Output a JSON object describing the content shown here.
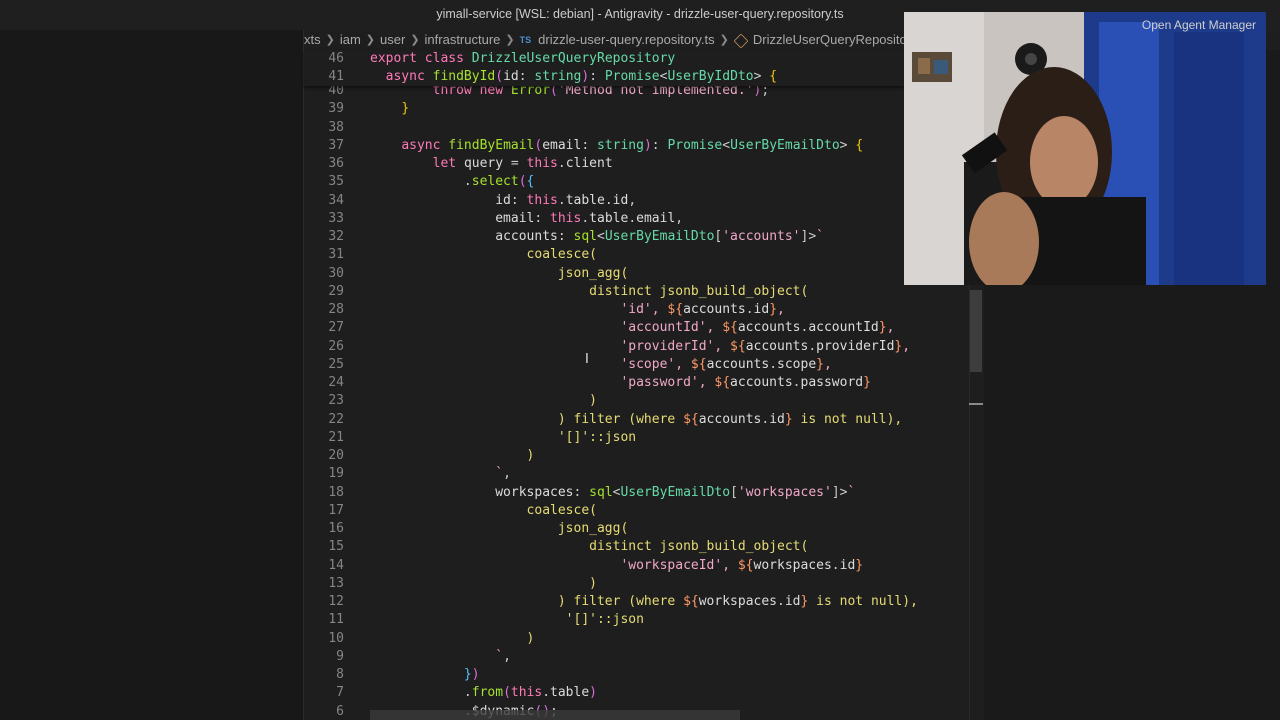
{
  "window": {
    "title": "yimall-service [WSL: debian] - Antigravity - drizzle-user-query.repository.ts"
  },
  "breadcrumbs": {
    "items": [
      "xts",
      "iam",
      "user",
      "infrastructure"
    ],
    "file_badge": "TS",
    "file_name": "drizzle-user-query.repository.ts",
    "symbol": "DrizzleUserQueryRepository"
  },
  "sticky_scroll": [
    {
      "ln": "46",
      "tokens": [
        [
          "kw",
          "export "
        ],
        [
          "kw",
          "class "
        ],
        [
          "ty",
          "DrizzleUserQueryRepository"
        ]
      ]
    },
    {
      "ln": "41",
      "tokens": [
        [
          "pn",
          "  "
        ],
        [
          "kw",
          "async "
        ],
        [
          "fn",
          "findById"
        ],
        [
          "br2",
          "("
        ],
        [
          "pr",
          "id"
        ],
        [
          "pn",
          ": "
        ],
        [
          "ty",
          "string"
        ],
        [
          "br2",
          ")"
        ],
        [
          "pn",
          ": "
        ],
        [
          "ty",
          "Promise"
        ],
        [
          "pn",
          "<"
        ],
        [
          "ty",
          "UserByIdDto"
        ],
        [
          "pn",
          "> "
        ],
        [
          "br",
          "{"
        ]
      ]
    }
  ],
  "code_lines": [
    {
      "ln": "40",
      "tokens": [
        [
          "pn",
          "        "
        ],
        [
          "kw",
          "throw "
        ],
        [
          "kw",
          "new "
        ],
        [
          "fn",
          "Error"
        ],
        [
          "br2",
          "("
        ],
        [
          "str",
          "'Method not implemented.'"
        ],
        [
          "br2",
          ")"
        ],
        [
          "pn",
          ";"
        ]
      ]
    },
    {
      "ln": "39",
      "tokens": [
        [
          "pn",
          "    "
        ],
        [
          "br",
          "}"
        ]
      ]
    },
    {
      "ln": "38",
      "tokens": []
    },
    {
      "ln": "37",
      "tokens": [
        [
          "pn",
          "    "
        ],
        [
          "kw",
          "async "
        ],
        [
          "fn",
          "findByEmail"
        ],
        [
          "br2",
          "("
        ],
        [
          "pr",
          "email"
        ],
        [
          "pn",
          ": "
        ],
        [
          "ty",
          "string"
        ],
        [
          "br2",
          ")"
        ],
        [
          "pn",
          ": "
        ],
        [
          "ty",
          "Promise"
        ],
        [
          "pn",
          "<"
        ],
        [
          "ty",
          "UserByEmailDto"
        ],
        [
          "pn",
          "> "
        ],
        [
          "br",
          "{"
        ]
      ]
    },
    {
      "ln": "36",
      "tokens": [
        [
          "pn",
          "        "
        ],
        [
          "kw",
          "let "
        ],
        [
          "pr",
          "query"
        ],
        [
          "pn",
          " = "
        ],
        [
          "kw",
          "this"
        ],
        [
          "pn",
          "."
        ],
        [
          "pr",
          "client"
        ]
      ]
    },
    {
      "ln": "35",
      "tokens": [
        [
          "pn",
          "            ."
        ],
        [
          "fn",
          "select"
        ],
        [
          "br2",
          "("
        ],
        [
          "br3",
          "{"
        ]
      ]
    },
    {
      "ln": "34",
      "tokens": [
        [
          "pn",
          "                "
        ],
        [
          "pr",
          "id"
        ],
        [
          "pn",
          ": "
        ],
        [
          "kw",
          "this"
        ],
        [
          "pn",
          "."
        ],
        [
          "pr",
          "table"
        ],
        [
          "pn",
          "."
        ],
        [
          "pr",
          "id"
        ],
        [
          "pn",
          ","
        ]
      ]
    },
    {
      "ln": "33",
      "tokens": [
        [
          "pn",
          "                "
        ],
        [
          "pr",
          "email"
        ],
        [
          "pn",
          ": "
        ],
        [
          "kw",
          "this"
        ],
        [
          "pn",
          "."
        ],
        [
          "pr",
          "table"
        ],
        [
          "pn",
          "."
        ],
        [
          "pr",
          "email"
        ],
        [
          "pn",
          ","
        ]
      ]
    },
    {
      "ln": "32",
      "tokens": [
        [
          "pn",
          "                "
        ],
        [
          "pr",
          "accounts"
        ],
        [
          "pn",
          ": "
        ],
        [
          "fn",
          "sql"
        ],
        [
          "pn",
          "<"
        ],
        [
          "ty",
          "UserByEmailDto"
        ],
        [
          "pn",
          "["
        ],
        [
          "str",
          "'accounts'"
        ],
        [
          "pn",
          "]>"
        ],
        [
          "str",
          "`"
        ]
      ]
    },
    {
      "ln": "31",
      "tokens": [
        [
          "pn",
          "                    "
        ],
        [
          "st",
          "coalesce("
        ]
      ]
    },
    {
      "ln": "30",
      "tokens": [
        [
          "pn",
          "                        "
        ],
        [
          "st",
          "json_agg("
        ]
      ]
    },
    {
      "ln": "29",
      "tokens": [
        [
          "pn",
          "                            "
        ],
        [
          "st",
          "distinct jsonb_build_object("
        ]
      ]
    },
    {
      "ln": "28",
      "tokens": [
        [
          "pn",
          "                                "
        ],
        [
          "str",
          "'id'"
        ],
        [
          "str",
          ", "
        ],
        [
          "tp",
          "${"
        ],
        [
          "pr",
          "accounts"
        ],
        [
          "pn",
          "."
        ],
        [
          "pr",
          "id"
        ],
        [
          "tp",
          "}"
        ],
        [
          "str",
          ","
        ]
      ]
    },
    {
      "ln": "27",
      "tokens": [
        [
          "pn",
          "                                "
        ],
        [
          "str",
          "'accountId'"
        ],
        [
          "str",
          ", "
        ],
        [
          "tp",
          "${"
        ],
        [
          "pr",
          "accounts"
        ],
        [
          "pn",
          "."
        ],
        [
          "pr",
          "accountId"
        ],
        [
          "tp",
          "}"
        ],
        [
          "str",
          ","
        ]
      ]
    },
    {
      "ln": "26",
      "tokens": [
        [
          "pn",
          "                                "
        ],
        [
          "str",
          "'providerId'"
        ],
        [
          "str",
          ", "
        ],
        [
          "tp",
          "${"
        ],
        [
          "pr",
          "accounts"
        ],
        [
          "pn",
          "."
        ],
        [
          "pr",
          "providerId"
        ],
        [
          "tp",
          "}"
        ],
        [
          "str",
          ","
        ]
      ]
    },
    {
      "ln": "25",
      "tokens": [
        [
          "pn",
          "                                "
        ],
        [
          "str",
          "'scope'"
        ],
        [
          "str",
          ", "
        ],
        [
          "tp",
          "${"
        ],
        [
          "pr",
          "accounts"
        ],
        [
          "pn",
          "."
        ],
        [
          "pr",
          "scope"
        ],
        [
          "tp",
          "}"
        ],
        [
          "str",
          ","
        ]
      ]
    },
    {
      "ln": "24",
      "tokens": [
        [
          "pn",
          "                                "
        ],
        [
          "str",
          "'password'"
        ],
        [
          "str",
          ", "
        ],
        [
          "tp",
          "${"
        ],
        [
          "pr",
          "accounts"
        ],
        [
          "pn",
          "."
        ],
        [
          "pr",
          "password"
        ],
        [
          "tp",
          "}"
        ]
      ]
    },
    {
      "ln": "23",
      "tokens": [
        [
          "pn",
          "                            "
        ],
        [
          "st",
          ")"
        ]
      ]
    },
    {
      "ln": "22",
      "tokens": [
        [
          "pn",
          "                        "
        ],
        [
          "st",
          ") filter (where "
        ],
        [
          "tp",
          "${"
        ],
        [
          "pr",
          "accounts"
        ],
        [
          "pn",
          "."
        ],
        [
          "pr",
          "id"
        ],
        [
          "tp",
          "}"
        ],
        [
          "st",
          " is not null),"
        ]
      ]
    },
    {
      "ln": "21",
      "tokens": [
        [
          "pn",
          "                        "
        ],
        [
          "st",
          "'[]'::json"
        ]
      ]
    },
    {
      "ln": "20",
      "tokens": [
        [
          "pn",
          "                    "
        ],
        [
          "st",
          ")"
        ]
      ]
    },
    {
      "ln": "19",
      "tokens": [
        [
          "pn",
          "                "
        ],
        [
          "str",
          "`"
        ],
        [
          "pn",
          ","
        ]
      ]
    },
    {
      "ln": "18",
      "tokens": [
        [
          "pn",
          "                "
        ],
        [
          "pr",
          "workspaces"
        ],
        [
          "pn",
          ": "
        ],
        [
          "fn",
          "sql"
        ],
        [
          "pn",
          "<"
        ],
        [
          "ty",
          "UserByEmailDto"
        ],
        [
          "pn",
          "["
        ],
        [
          "str",
          "'workspaces'"
        ],
        [
          "pn",
          "]>"
        ],
        [
          "str",
          "`"
        ]
      ]
    },
    {
      "ln": "17",
      "tokens": [
        [
          "pn",
          "                    "
        ],
        [
          "st",
          "coalesce("
        ]
      ]
    },
    {
      "ln": "16",
      "tokens": [
        [
          "pn",
          "                        "
        ],
        [
          "st",
          "json_agg("
        ]
      ]
    },
    {
      "ln": "15",
      "tokens": [
        [
          "pn",
          "                            "
        ],
        [
          "st",
          "distinct jsonb_build_object("
        ]
      ]
    },
    {
      "ln": "14",
      "tokens": [
        [
          "pn",
          "                                "
        ],
        [
          "str",
          "'workspaceId'"
        ],
        [
          "str",
          ", "
        ],
        [
          "tp",
          "${"
        ],
        [
          "pr",
          "workspaces"
        ],
        [
          "pn",
          "."
        ],
        [
          "pr",
          "id"
        ],
        [
          "tp",
          "}"
        ]
      ]
    },
    {
      "ln": "13",
      "tokens": [
        [
          "pn",
          "                            "
        ],
        [
          "st",
          ")"
        ]
      ]
    },
    {
      "ln": "12",
      "tokens": [
        [
          "pn",
          "                        "
        ],
        [
          "st",
          ") filter (where "
        ],
        [
          "tp",
          "${"
        ],
        [
          "pr",
          "workspaces"
        ],
        [
          "pn",
          "."
        ],
        [
          "pr",
          "id"
        ],
        [
          "tp",
          "}"
        ],
        [
          "st",
          " is not null),"
        ]
      ]
    },
    {
      "ln": "11",
      "tokens": [
        [
          "pn",
          "                         "
        ],
        [
          "st",
          "'[]'::json"
        ]
      ]
    },
    {
      "ln": "10",
      "tokens": [
        [
          "pn",
          "                    "
        ],
        [
          "st",
          ")"
        ]
      ]
    },
    {
      "ln": "9",
      "tokens": [
        [
          "pn",
          "                "
        ],
        [
          "str",
          "`"
        ],
        [
          "pn",
          ","
        ]
      ]
    },
    {
      "ln": "8",
      "tokens": [
        [
          "pn",
          "            "
        ],
        [
          "br3",
          "}"
        ],
        [
          "br2",
          ")"
        ]
      ]
    },
    {
      "ln": "7",
      "tokens": [
        [
          "pn",
          "            ."
        ],
        [
          "fn",
          "from"
        ],
        [
          "br2",
          "("
        ],
        [
          "kw",
          "this"
        ],
        [
          "pn",
          "."
        ],
        [
          "pr",
          "table"
        ],
        [
          "br2",
          ")"
        ]
      ]
    },
    {
      "ln": "6",
      "tokens": [
        [
          "pn",
          "            ."
        ],
        [
          "pr",
          "$dynamic"
        ],
        [
          "br2",
          "()"
        ],
        [
          "pn",
          ";"
        ]
      ]
    }
  ],
  "overlay": {
    "webcam_header_text": "Open Agent Manager"
  }
}
